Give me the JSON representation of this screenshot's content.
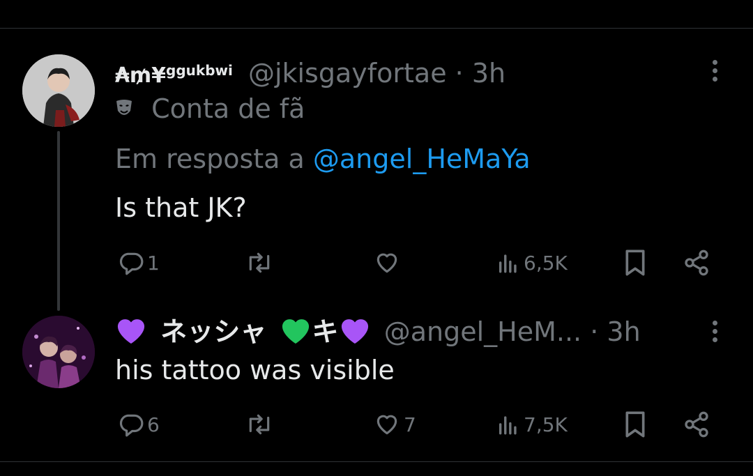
{
  "tweets": [
    {
      "display_name": "₳₥¥",
      "display_name_sup": "ggukbwi",
      "handle": "@jkisgayfortae",
      "separator": "·",
      "time": "3h",
      "badge_label": "Conta de fã",
      "reply_prefix": "Em resposta a",
      "reply_to": "@angel_HeMaYa",
      "text": "Is that JK?",
      "actions": {
        "replies": "1",
        "retweets": "",
        "likes": "",
        "views": "6,5K"
      }
    },
    {
      "display_name_parts": [
        "ネッシャ",
        "キ"
      ],
      "handle": "@angel_HeM...",
      "separator": "·",
      "time": "3h",
      "text": "his tattoo was visible",
      "actions": {
        "replies": "6",
        "retweets": "",
        "likes": "7",
        "views": "7,5K"
      }
    }
  ],
  "colors": {
    "background": "#000000",
    "text_primary": "#e7e9ea",
    "text_muted": "#71767b",
    "link": "#1d9bf0",
    "purple_heart": "#a855f7",
    "green_heart": "#22c55e"
  },
  "icons": [
    "fan-mask-icon",
    "reply-icon",
    "retweet-icon",
    "like-icon",
    "views-icon",
    "bookmark-icon",
    "share-icon",
    "more-icon",
    "purple-heart-icon",
    "green-heart-icon"
  ]
}
